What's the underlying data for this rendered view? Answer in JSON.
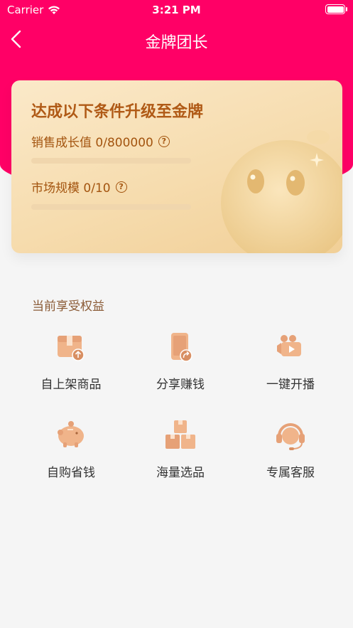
{
  "status_bar": {
    "carrier": "Carrier",
    "time": "3:21 PM"
  },
  "nav": {
    "title": "金牌团长"
  },
  "card": {
    "heading": "达成以下条件升级至金牌",
    "conditions": [
      {
        "label": "销售成长值 0/800000",
        "progress": 0
      },
      {
        "label": "市场规模 0/10",
        "progress": 0
      }
    ]
  },
  "benefits": {
    "title": "当前享受权益",
    "items": [
      {
        "label": "自上架商品",
        "icon": "box-upload-icon"
      },
      {
        "label": "分享赚钱",
        "icon": "phone-share-icon"
      },
      {
        "label": "一键开播",
        "icon": "video-camera-icon"
      },
      {
        "label": "自购省钱",
        "icon": "piggy-bank-icon"
      },
      {
        "label": "海量选品",
        "icon": "boxes-icon"
      },
      {
        "label": "专属客服",
        "icon": "headset-icon"
      }
    ]
  },
  "colors": {
    "brand": "#ff0066",
    "accent": "#a9520e",
    "icon": "#e6a177"
  }
}
